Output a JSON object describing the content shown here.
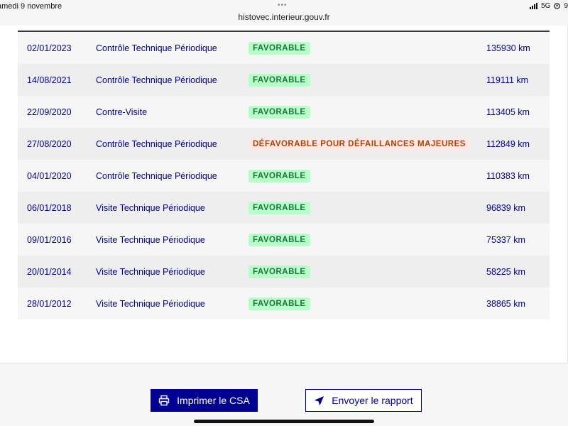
{
  "status_bar": {
    "time": "amedi 9 novembre",
    "dots": "•••",
    "url": "histovec.interieur.gouv.fr",
    "network": "5G",
    "edge_text": "9"
  },
  "inspections": {
    "rows": [
      {
        "date": "02/01/2023",
        "type": "Contrôle Technique Périodique",
        "result": "FAVORABLE",
        "status": "ok",
        "km": "135930 km"
      },
      {
        "date": "14/08/2021",
        "type": "Contrôle Technique Périodique",
        "result": "FAVORABLE",
        "status": "ok",
        "km": "119111 km"
      },
      {
        "date": "22/09/2020",
        "type": "Contre-Visite",
        "result": "FAVORABLE",
        "status": "ok",
        "km": "113405 km"
      },
      {
        "date": "27/08/2020",
        "type": "Contrôle Technique Périodique",
        "result": "DÉFAVORABLE POUR DÉFAILLANCES MAJEURES",
        "status": "ko",
        "km": "112849 km"
      },
      {
        "date": "04/01/2020",
        "type": "Contrôle Technique Périodique",
        "result": "FAVORABLE",
        "status": "ok",
        "km": "110383 km"
      },
      {
        "date": "06/01/2018",
        "type": "Visite Technique Périodique",
        "result": "FAVORABLE",
        "status": "ok",
        "km": "96839 km"
      },
      {
        "date": "09/01/2016",
        "type": "Visite Technique Périodique",
        "result": "FAVORABLE",
        "status": "ok",
        "km": "75337 km"
      },
      {
        "date": "20/01/2014",
        "type": "Visite Technique Périodique",
        "result": "FAVORABLE",
        "status": "ok",
        "km": "58225 km"
      },
      {
        "date": "28/01/2012",
        "type": "Visite Technique Périodique",
        "result": "FAVORABLE",
        "status": "ok",
        "km": "38865 km"
      }
    ]
  },
  "footer": {
    "print_label": "Imprimer le CSA",
    "print_icon": "printer-icon",
    "send_label": "Envoyer le rapport",
    "send_icon": "send-icon"
  },
  "colors": {
    "primary": "#000091",
    "favorable_bg": "#b8fec9",
    "favorable_text": "#18753c",
    "defavorable_bg": "#ffe9e6",
    "defavorable_text": "#b34000"
  }
}
